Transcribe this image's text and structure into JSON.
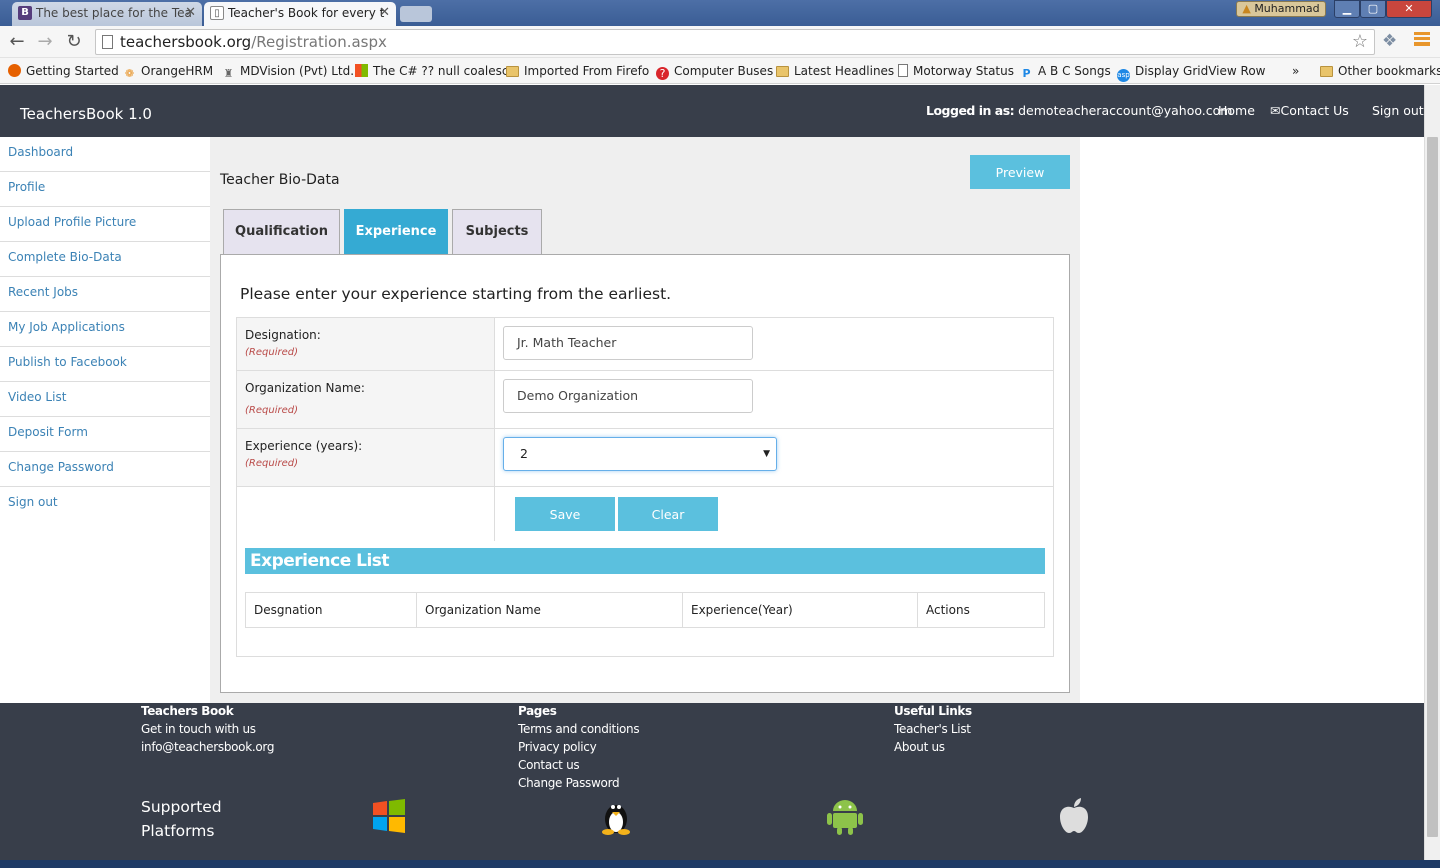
{
  "browser": {
    "tabs": [
      {
        "title": "The best place for the Tea",
        "favicon": "B"
      },
      {
        "title": "Teacher's Book for every t",
        "favicon": "page-icon"
      }
    ],
    "profile_name": "Muhammad",
    "window_controls": {
      "minimize": "▁",
      "maximize": "▢",
      "close": "✕"
    },
    "url_host": "teachersbook.org",
    "url_path": "/Registration.aspx",
    "bookmarks": [
      "Getting Started",
      "OrangeHRM",
      "MDVision (Pvt) Ltd.",
      "The C# ?? null coalesc",
      "Imported From Firefo",
      "Computer Buses",
      "Latest Headlines",
      "Motorway Status",
      "A B C Songs",
      "Display GridView Row"
    ],
    "bookmarks_overflow": "»",
    "other_bookmarks": "Other bookmarks"
  },
  "header": {
    "brand": "TeachersBook 1.0",
    "logged_label": "Logged in as:",
    "logged_user": "demoteacheraccount@yahoo.com",
    "home": "Home",
    "contact": "Contact Us",
    "signout": "Sign out"
  },
  "sidebar": {
    "items": [
      "Dashboard",
      "Profile",
      "Upload Profile Picture",
      "Complete Bio-Data",
      "Recent Jobs",
      "My Job Applications",
      "Publish to Facebook",
      "Video List",
      "Deposit Form",
      "Change Password",
      "Sign out"
    ]
  },
  "main": {
    "title": "Teacher Bio-Data",
    "preview": "Preview",
    "tabs": [
      "Qualification",
      "Experience",
      "Subjects"
    ],
    "active_tab": "Experience",
    "intro": "Please enter your experience starting from the earliest.",
    "form": {
      "designation_label": "Designation:",
      "designation_value": "Jr. Math Teacher",
      "org_label": "Organization Name:",
      "org_value": "Demo Organization",
      "exp_label": "Experience (years):",
      "exp_value": "2",
      "required": "(Required)",
      "save": "Save",
      "clear": "Clear"
    },
    "list": {
      "heading": "Experience List",
      "columns": [
        "Desgnation",
        "Organization Name",
        "Experience(Year)",
        "Actions"
      ]
    }
  },
  "footer": {
    "col1": {
      "heading": "Teachers Book",
      "lines": [
        "Get in touch with us",
        "info@teachersbook.org"
      ]
    },
    "col2": {
      "heading": "Pages",
      "lines": [
        "Terms and conditions",
        "Privacy policy",
        "Contact us",
        "Change Password"
      ]
    },
    "col3": {
      "heading": "Useful Links",
      "lines": [
        "Teacher's List",
        "About us"
      ]
    },
    "platforms_label": "Supported Platforms",
    "platforms": [
      "windows-icon",
      "linux-icon",
      "android-icon",
      "apple-icon"
    ]
  },
  "colors": {
    "accent": "#5bc0de",
    "header_bg": "#383e4a",
    "link": "#3b82b5",
    "required": "#b94a48"
  }
}
